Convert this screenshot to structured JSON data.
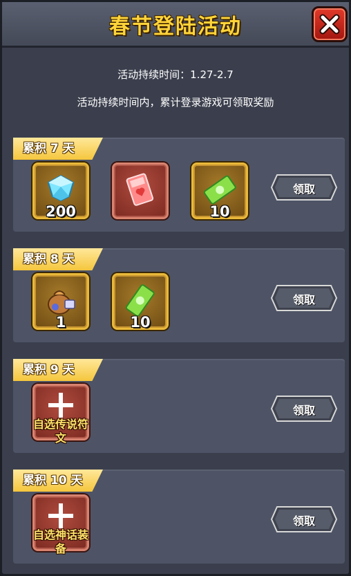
{
  "header": {
    "title": "春节登陆活动"
  },
  "info": {
    "duration": "活动持续时间：1.27-2.7",
    "description": "活动持续时间内，累计登录游戏可领取奖励"
  },
  "rows": [
    {
      "tag": "累积 7 天",
      "claim_label": "领取",
      "items": [
        {
          "icon": "diamond-icon",
          "quantity": "200"
        },
        {
          "icon": "red-card-icon",
          "quantity": ""
        },
        {
          "icon": "green-ticket-icon",
          "quantity": "10"
        }
      ]
    },
    {
      "tag": "累积 8 天",
      "claim_label": "领取",
      "items": [
        {
          "icon": "bag-icon",
          "quantity": "1"
        },
        {
          "icon": "green-ticket-icon",
          "quantity": "10"
        }
      ]
    },
    {
      "tag": "累积 9 天",
      "claim_label": "领取",
      "items": [
        {
          "icon": "plus-icon",
          "label": "自选传说符文"
        }
      ]
    },
    {
      "tag": "累积 10 天",
      "claim_label": "领取",
      "items": [
        {
          "icon": "plus-icon",
          "label": "自选神话装备"
        }
      ]
    }
  ],
  "colors": {
    "title": "#ffd43a",
    "tag": "#f5c63d",
    "row_bg": "#4e5466",
    "panel_bg": "#3b3f4d",
    "close_button": "#c7251a"
  }
}
